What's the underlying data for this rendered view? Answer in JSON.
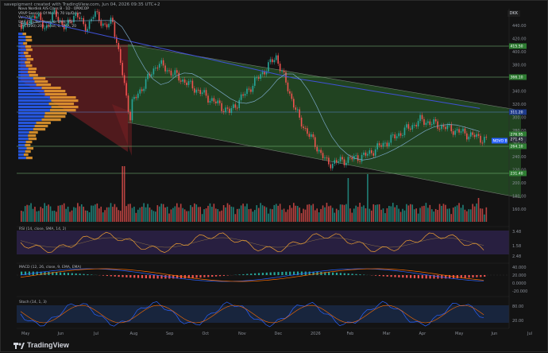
{
  "credit": "savepigment created with TradingView.com, Jun 04, 2026 09:35 UTC+2",
  "legend": {
    "symbol_line": "Novo Nordisk A/S Class B · 1D · OMXCOP",
    "line2": "VRVP Session Of Month 70 Up/Down",
    "line3": "Vol (20)",
    "line4": "SMA (50) 50, close, 0, SMA, 20",
    "line5": "SMA (200) 200, close, 0, SMA, 20"
  },
  "currency": "DKK",
  "price_axis": {
    "labels": [
      "440.00",
      "420.00",
      "400.00",
      "380.00",
      "360.00",
      "340.00",
      "320.00",
      "300.00",
      "280.00",
      "260.00",
      "240.00",
      "220.00",
      "200.00",
      "180.00",
      "160.00"
    ],
    "tags": [
      {
        "text": "415.50",
        "color": "#2e7d32"
      },
      {
        "text": "366.10",
        "color": "#2e7d32"
      },
      {
        "text": "311.20",
        "color": "#1e3a8a"
      },
      {
        "text": "276.95",
        "color": "#2e7d32"
      },
      {
        "text": "271.45",
        "color": "#2a2e39"
      },
      {
        "text": "264.10",
        "color": "#2e7d32"
      },
      {
        "text": "231.40",
        "color": "#2e7d32"
      },
      {
        "text": "NOVO B",
        "color": "#2962ff"
      }
    ]
  },
  "rsi": {
    "title": "RSI (14, close, SMA, 14, 2)",
    "values_text": "44.64  45.8",
    "labels": [
      "3.48",
      "1.58",
      "2.48"
    ]
  },
  "macd": {
    "title": "MACD (12, 26, close, 9, EMA, EMA)",
    "values_text": "-3.458  -1.1739  -4.997",
    "labels": [
      "40.000",
      "20.000",
      "0.0000",
      "-20.000"
    ]
  },
  "stoch": {
    "title": "Stoch (14, 1, 3)",
    "values_text": "9.41  12.46",
    "labels": [
      "80.00",
      "20.00"
    ]
  },
  "time_axis": [
    "May",
    "Jun",
    "Jul",
    "Aug",
    "Sep",
    "Oct",
    "Nov",
    "Dec",
    "2026",
    "Feb",
    "Mar",
    "Apr",
    "May",
    "Jun",
    "Jul"
  ],
  "brand": "TradingView",
  "colors": {
    "up": "#26a69a",
    "down": "#ef5350",
    "sma50": "#7aa7c7",
    "sma200": "#3f51d5",
    "channel_fill": "#2e6b2e",
    "channel_red": "#7a1f24",
    "rsi_band": "#3a2a66",
    "stoch_band": "#1d3560"
  }
}
